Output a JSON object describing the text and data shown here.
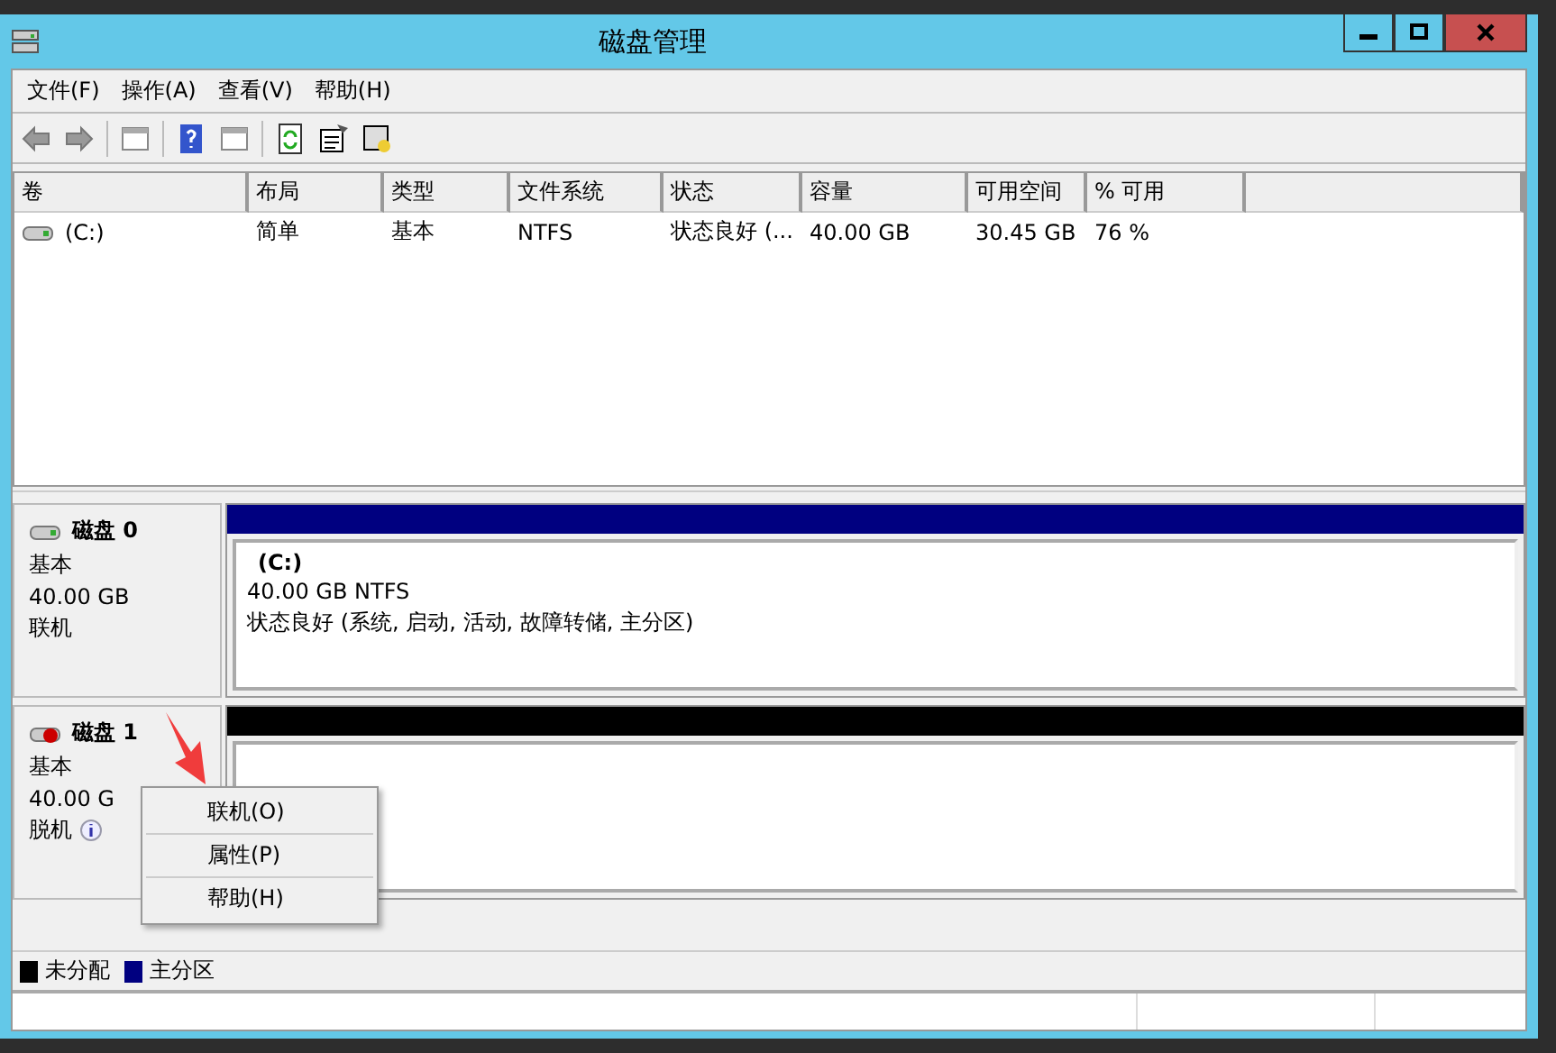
{
  "window": {
    "title": "磁盘管理"
  },
  "menu": [
    "文件(F)",
    "操作(A)",
    "查看(V)",
    "帮助(H)"
  ],
  "table": {
    "columns": [
      "卷",
      "布局",
      "类型",
      "文件系统",
      "状态",
      "容量",
      "可用空间",
      "% 可用"
    ],
    "rows": [
      {
        "cells": [
          "(C:)",
          "简单",
          "基本",
          "NTFS",
          "状态良好 (...",
          "40.00 GB",
          "30.45 GB",
          "76 %"
        ]
      }
    ]
  },
  "disks": [
    {
      "name": "磁盘 0",
      "type": "基本",
      "size": "40.00 GB",
      "status": "联机",
      "online": true,
      "partition": {
        "kind": "primary",
        "label": "(C:)",
        "size": "40.00 GB NTFS",
        "state": "状态良好 (系统, 启动, 活动, 故障转储, 主分区)"
      }
    },
    {
      "name": "磁盘 1",
      "type": "基本",
      "size": "40.00 G",
      "status": "脱机",
      "online": false,
      "partition": {
        "kind": "unallocated"
      }
    }
  ],
  "context_menu": [
    "联机(O)",
    "属性(P)",
    "帮助(H)"
  ],
  "legend": [
    {
      "label": "未分配",
      "color": "#000000"
    },
    {
      "label": "主分区",
      "color": "#000080"
    }
  ]
}
